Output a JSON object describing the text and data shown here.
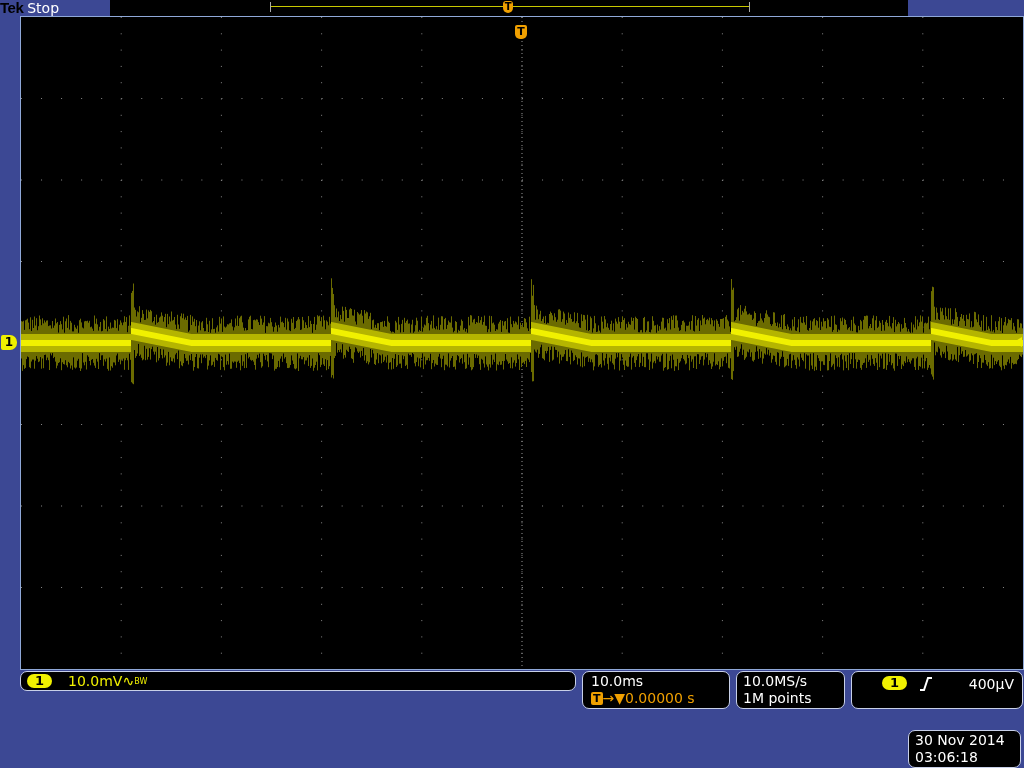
{
  "header": {
    "brand": "Tek",
    "acquisition_status": "Stop"
  },
  "record_view": {
    "trigger_marker": "T"
  },
  "graticule": {
    "trigger_marker": "T",
    "channel_marker": "1"
  },
  "channel": {
    "number": "1",
    "scale": "10.0mV",
    "coupling_symbol": "∿",
    "bandwidth_mark": "BW"
  },
  "timebase": {
    "scale": "10.0ms",
    "trigger_badge": "T",
    "delay_arrows": "→▼",
    "delay": "0.00000 s"
  },
  "acquisition": {
    "sample_rate": "10.0MS/s",
    "record_length": "1M points"
  },
  "trigger": {
    "source": "1",
    "rising_slope": true,
    "level": "400µV"
  },
  "clock": {
    "date": "30 Nov 2014",
    "time": "03:06:18"
  }
}
